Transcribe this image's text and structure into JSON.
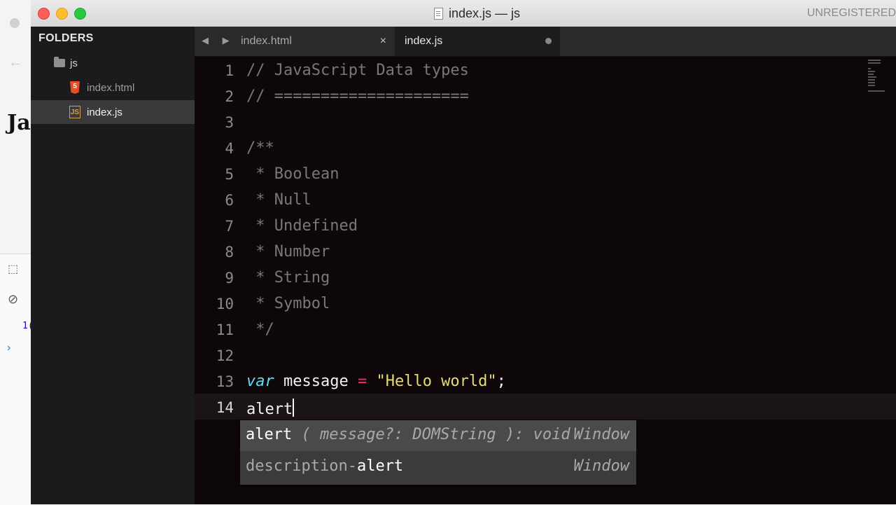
{
  "window": {
    "title": "index.js — js",
    "unregistered": "UNREGISTERED"
  },
  "sidebar": {
    "header": "FOLDERS",
    "tree": [
      {
        "label": "js",
        "type": "folder"
      },
      {
        "label": "index.html",
        "type": "file-html"
      },
      {
        "label": "index.js",
        "type": "file-js",
        "selected": true
      }
    ],
    "js_icon_text": "JS",
    "html_icon_text": "5"
  },
  "tabs": [
    {
      "label": "index.html",
      "close": "×"
    },
    {
      "label": "index.js",
      "dirty": true
    }
  ],
  "tab_nav": "◀ ▶",
  "editor": {
    "line_numbers": [
      "1",
      "2",
      "3",
      "4",
      "5",
      "6",
      "7",
      "8",
      "9",
      "10",
      "11",
      "12",
      "13",
      "14"
    ],
    "active_line": 14,
    "lines": {
      "l1": "// JavaScript Data types",
      "l2": "// =====================",
      "l3": "",
      "l4": "/**",
      "l5": " * Boolean",
      "l6": " * Null",
      "l7": " * Undefined",
      "l8": " * Number",
      "l9": " * String",
      "l10": " * Symbol",
      "l11": " */",
      "l12": "",
      "l13_kw": "var",
      "l13_name": " message ",
      "l13_op": "=",
      "l13_str": " \"Hello world\"",
      "l13_end": ";",
      "l14": "alert"
    }
  },
  "autocomplete": {
    "items": [
      {
        "match": "alert",
        "signature": " ( message?: DOMString ): void",
        "hint": "Window"
      },
      {
        "prefix": "description-",
        "match": "alert",
        "hint": "Window"
      }
    ]
  },
  "background_window": {
    "heading": "Ja",
    "console_number": "1(",
    "prompt": "›"
  },
  "colors": {
    "editor_bg": "#0d070a",
    "comment": "#7a7777",
    "keyword": "#66d9ef",
    "operator": "#f92672",
    "string": "#e6db74"
  }
}
